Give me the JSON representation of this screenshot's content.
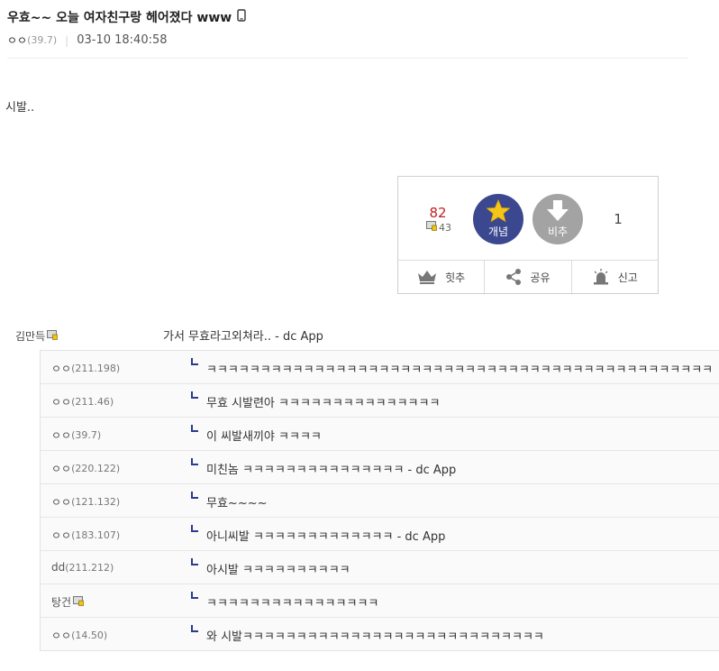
{
  "post": {
    "title": "우효~~ 오늘 여자친구랑 헤어졌다 www",
    "author_nick": "ㅇㅇ",
    "author_ip": "(39.7)",
    "date": "03-10 18:40:58",
    "body": "시발.."
  },
  "vote": {
    "up_count": "82",
    "fixed_count": "43",
    "up_label": "개념",
    "down_label": "비추",
    "down_count": "1",
    "buttons": [
      {
        "label": "힛추"
      },
      {
        "label": "공유"
      },
      {
        "label": "신고"
      }
    ]
  },
  "comment": {
    "nick": "김만득",
    "text": "가서 무효라고외쳐라.. - dc App"
  },
  "replies": [
    {
      "nick": "ㅇㅇ",
      "ip": "(211.198)",
      "text": "ㅋㅋㅋㅋㅋㅋㅋㅋㅋㅋㅋㅋㅋㅋㅋㅋㅋㅋㅋㅋㅋㅋㅋㅋㅋㅋㅋㅋㅋㅋㅋㅋㅋㅋㅋㅋㅋㅋㅋㅋㅋㅋㅋㅋㅋㅋㅋ"
    },
    {
      "nick": "ㅇㅇ",
      "ip": "(211.46)",
      "text": "무효 시발련아 ㅋㅋㅋㅋㅋㅋㅋㅋㅋㅋㅋㅋㅋㅋㅋ"
    },
    {
      "nick": "ㅇㅇ",
      "ip": "(39.7)",
      "text": "이 씨발새끼야 ㅋㅋㅋㅋ"
    },
    {
      "nick": "ㅇㅇ",
      "ip": "(220.122)",
      "text": "미친놈 ㅋㅋㅋㅋㅋㅋㅋㅋㅋㅋㅋㅋㅋㅋㅋ - dc App"
    },
    {
      "nick": "ㅇㅇ",
      "ip": "(121.132)",
      "text": "무효~~~~"
    },
    {
      "nick": "ㅇㅇ",
      "ip": "(183.107)",
      "text": "아니씨발 ㅋㅋㅋㅋㅋㅋㅋㅋㅋㅋㅋㅋㅋ - dc App"
    },
    {
      "nick": "dd",
      "ip": "(211.212)",
      "text": "아시발 ㅋㅋㅋㅋㅋㅋㅋㅋㅋㅋ"
    },
    {
      "nick": "탕건",
      "ip": "",
      "text": "ㅋㅋㅋㅋㅋㅋㅋㅋㅋㅋㅋㅋㅋㅋㅋㅋ"
    },
    {
      "nick": "ㅇㅇ",
      "ip": "(14.50)",
      "text": "와 시발ㅋㅋㅋㅋㅋㅋㅋㅋㅋㅋㅋㅋㅋㅋㅋㅋㅋㅋㅋㅋㅋㅋㅋㅋㅋㅋㅋㅋ"
    }
  ],
  "colors": {
    "up_circle": "#3b4890",
    "down_circle": "#a3a3a3",
    "up_count": "#c01f1f",
    "reply_arrow": "#2a3b8f"
  },
  "icons": [
    "phone-icon",
    "fixed-nick-icon",
    "star-icon",
    "down-arrow-icon",
    "crown-icon",
    "share-icon",
    "siren-icon"
  ]
}
